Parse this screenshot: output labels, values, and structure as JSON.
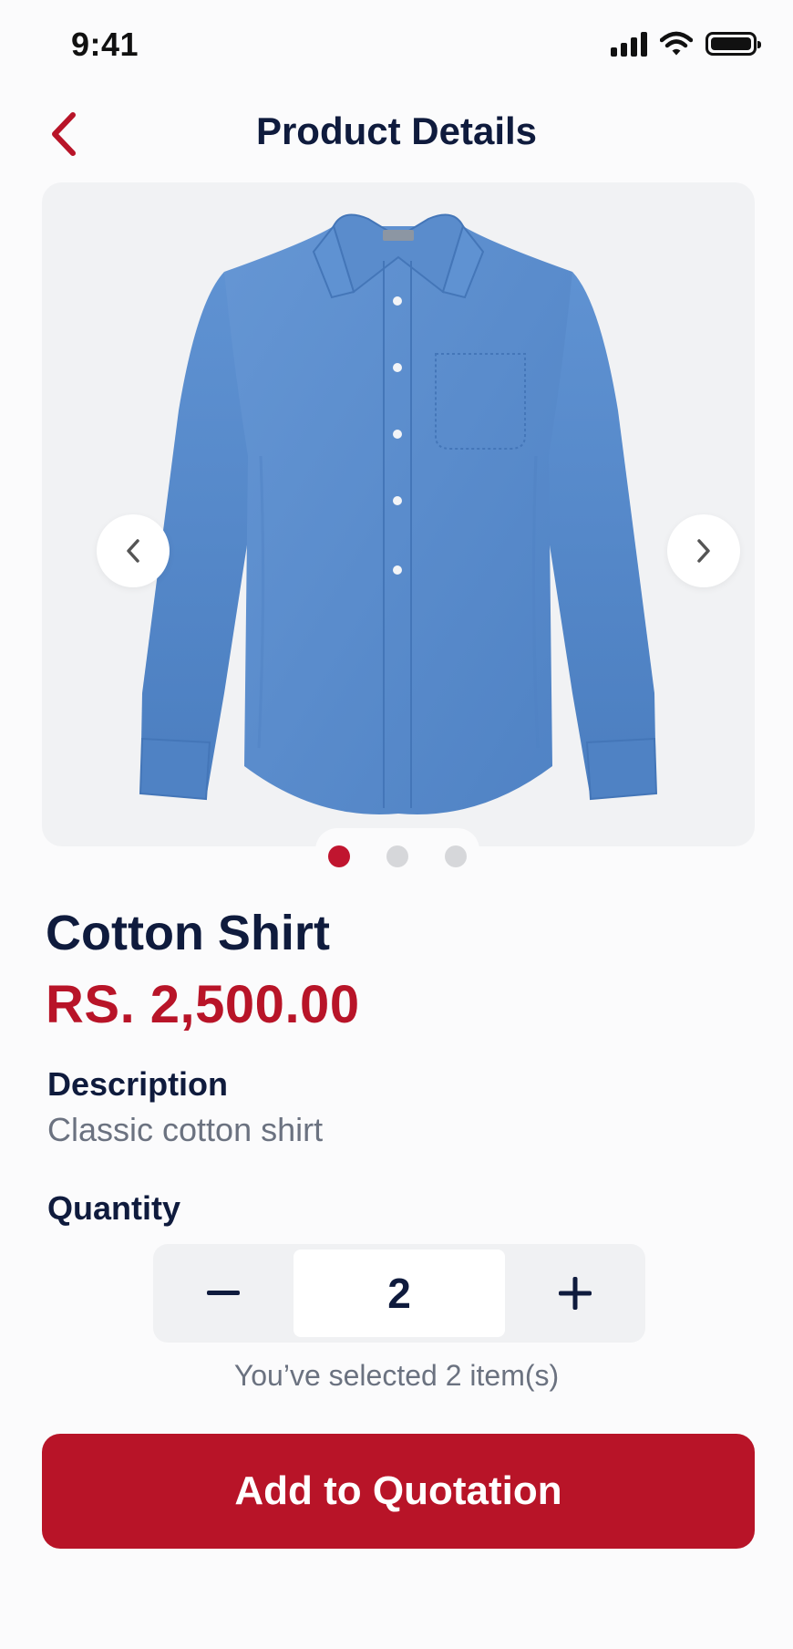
{
  "status_bar": {
    "time": "9:41",
    "icons": [
      "cellular-signal-icon",
      "wifi-icon",
      "battery-icon"
    ]
  },
  "header": {
    "title": "Product Details",
    "back_icon": "chevron-left-icon"
  },
  "gallery": {
    "image_subject": "blue long-sleeve button-up shirt",
    "prev_icon": "chevron-left-icon",
    "next_icon": "chevron-right-icon",
    "page_count": 3,
    "active_index": 0
  },
  "product": {
    "name": "Cotton Shirt",
    "price": "RS. 2,500.00"
  },
  "description": {
    "heading": "Description",
    "text": "Classic cotton shirt"
  },
  "quantity": {
    "heading": "Quantity",
    "value": "2",
    "decrement_label": "−",
    "increment_label": "+",
    "note": "You’ve selected 2 item(s)"
  },
  "cta": {
    "label": "Add to Quotation"
  },
  "colors": {
    "accent": "#b81428",
    "title": "#0f1b3d",
    "muted": "#6b7280",
    "card_bg": "#f1f2f4",
    "shirt": "#5b8fcf"
  }
}
